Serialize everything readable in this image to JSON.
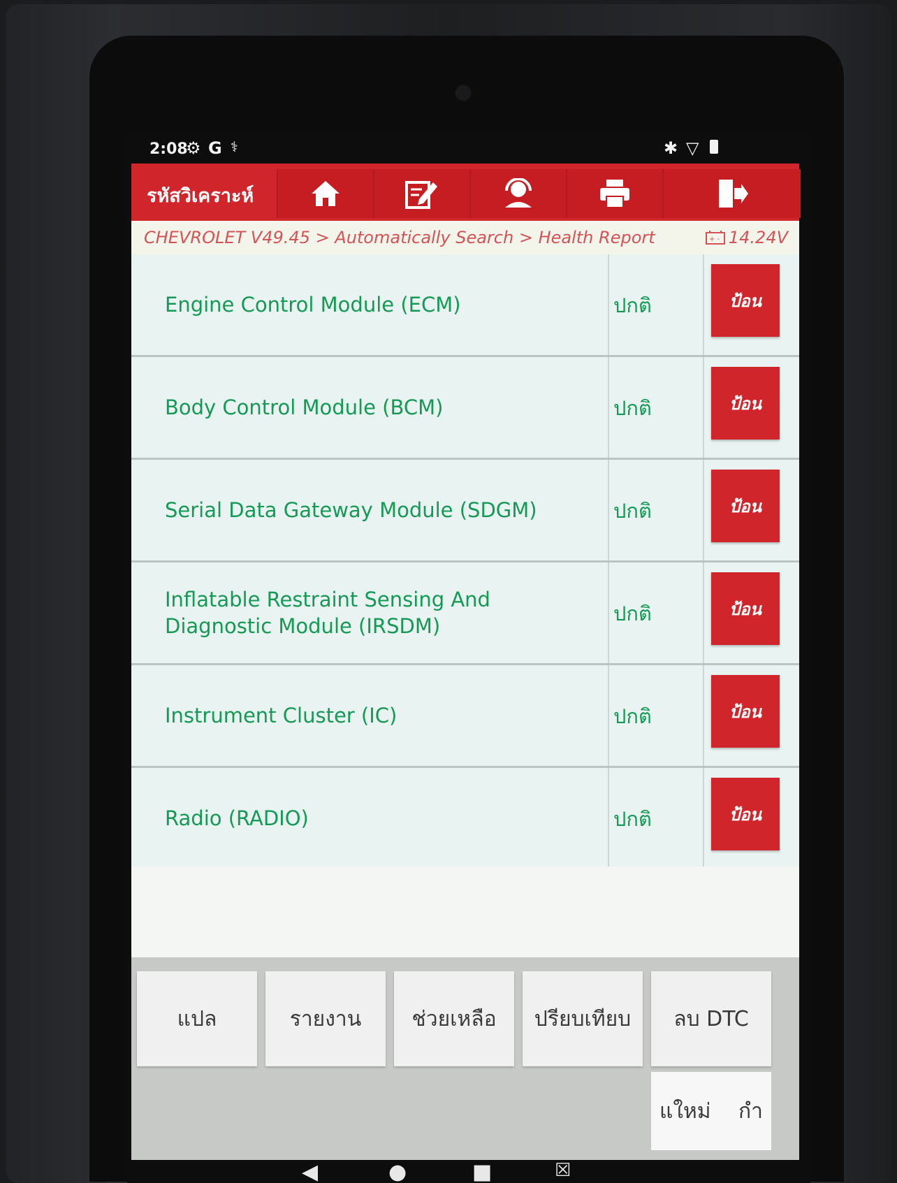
{
  "status_bar": {
    "time": "2:08",
    "left_icons": [
      "settings-badge-icon",
      "google-icon",
      "stethoscope-icon"
    ],
    "right_icons": [
      "bluetooth-icon",
      "wifi-icon",
      "battery-icon"
    ]
  },
  "header": {
    "title": "รหัสวิเคราะห์",
    "buttons": [
      "home-icon",
      "edit-icon",
      "support-icon",
      "print-icon",
      "exit-icon"
    ],
    "color": "#d0262b"
  },
  "breadcrumb": {
    "path": "CHEVROLET V49.45 > Automatically Search > Health Report",
    "voltage": "14.24V"
  },
  "modules": [
    {
      "name": "Engine Control Module (ECM)",
      "status": "ปกติ",
      "action": "ป้อน"
    },
    {
      "name": "Body Control Module (BCM)",
      "status": "ปกติ",
      "action": "ป้อน"
    },
    {
      "name": "Serial Data Gateway Module (SDGM)",
      "status": "ปกติ",
      "action": "ป้อน"
    },
    {
      "name": "Inflatable Restraint Sensing And Diagnostic Module (IRSDM)",
      "status": "ปกติ",
      "action": "ป้อน"
    },
    {
      "name": "Instrument Cluster (IC)",
      "status": "ปกติ",
      "action": "ป้อน"
    },
    {
      "name": "Radio (RADIO)",
      "status": "ปกติ",
      "action": "ป้อน"
    }
  ],
  "toolbar": {
    "translate": "แปล",
    "report": "รายงาน",
    "help": "ช่วยเหลือ",
    "compare": "ปรียบเทียบ",
    "clear_dtc": "ลบ DTC",
    "new_label_a": "แใหม่",
    "new_label_b": "กำ"
  },
  "accent_green": "#159a56"
}
